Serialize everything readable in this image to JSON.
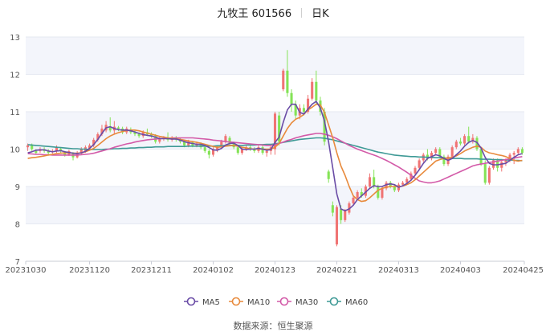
{
  "header": {
    "stock_name": "九牧王 601566",
    "period": "日K"
  },
  "footer": {
    "source": "数据来源：恒生聚源"
  },
  "colors": {
    "up": "#f07474",
    "down": "#84e356",
    "MA5": "#6a4ca6",
    "MA10": "#e88a3c",
    "MA30": "#d35aa8",
    "MA60": "#3f9a96",
    "grid": "#e6e9f2",
    "band": "#f3f5fb"
  },
  "chart_data": {
    "type": "candlestick",
    "title": "九牧王 601566",
    "ylim": [
      7,
      13
    ],
    "yticks": [
      7,
      8,
      9,
      10,
      11,
      12,
      13
    ],
    "xticks": [
      "20231030",
      "20231120",
      "20231211",
      "20240102",
      "20240123",
      "20240221",
      "20240313",
      "20240403",
      "20240425"
    ],
    "xtick_index": [
      0,
      15,
      30,
      45,
      60,
      75,
      90,
      105,
      120
    ],
    "n_bars": 121,
    "legend": [
      "MA5",
      "MA10",
      "MA30",
      "MA60"
    ],
    "legend_position": "bottom",
    "candles": [
      [
        10.05,
        10.1,
        9.95,
        10.15
      ],
      [
        10.1,
        10.0,
        9.95,
        10.15
      ],
      [
        9.95,
        9.9,
        9.85,
        10.0
      ],
      [
        9.95,
        10.0,
        9.9,
        10.05
      ],
      [
        10.0,
        9.95,
        9.9,
        10.05
      ],
      [
        9.95,
        9.9,
        9.85,
        10.0
      ],
      [
        9.92,
        9.95,
        9.88,
        10.0
      ],
      [
        9.95,
        10.05,
        9.9,
        10.1
      ],
      [
        10.0,
        9.95,
        9.9,
        10.05
      ],
      [
        9.9,
        9.85,
        9.8,
        9.95
      ],
      [
        9.85,
        9.95,
        9.82,
        9.98
      ],
      [
        9.88,
        9.78,
        9.7,
        9.92
      ],
      [
        9.78,
        9.9,
        9.75,
        9.95
      ],
      [
        9.88,
        10.0,
        9.85,
        10.05
      ],
      [
        9.95,
        10.05,
        9.9,
        10.1
      ],
      [
        10.02,
        10.1,
        10.0,
        10.15
      ],
      [
        10.1,
        10.25,
        10.05,
        10.3
      ],
      [
        10.25,
        10.4,
        10.2,
        10.45
      ],
      [
        10.4,
        10.55,
        10.35,
        10.65
      ],
      [
        10.5,
        10.65,
        10.45,
        10.75
      ],
      [
        10.6,
        10.5,
        10.45,
        10.85
      ],
      [
        10.5,
        10.6,
        10.4,
        10.75
      ],
      [
        10.58,
        10.55,
        10.48,
        10.62
      ],
      [
        10.55,
        10.45,
        10.4,
        10.6
      ],
      [
        10.45,
        10.55,
        10.4,
        10.6
      ],
      [
        10.52,
        10.45,
        10.4,
        10.58
      ],
      [
        10.45,
        10.4,
        10.35,
        10.5
      ],
      [
        10.4,
        10.35,
        10.3,
        10.45
      ],
      [
        10.35,
        10.45,
        10.3,
        10.5
      ],
      [
        10.45,
        10.4,
        10.35,
        10.55
      ],
      [
        10.4,
        10.35,
        10.3,
        10.45
      ],
      [
        10.35,
        10.2,
        10.15,
        10.4
      ],
      [
        10.2,
        10.3,
        10.15,
        10.35
      ],
      [
        10.28,
        10.3,
        10.22,
        10.35
      ],
      [
        10.3,
        10.25,
        10.2,
        10.45
      ],
      [
        10.25,
        10.3,
        10.2,
        10.35
      ],
      [
        10.3,
        10.25,
        10.2,
        10.35
      ],
      [
        10.25,
        10.2,
        10.15,
        10.3
      ],
      [
        10.2,
        10.1,
        10.05,
        10.25
      ],
      [
        10.1,
        10.2,
        10.05,
        10.25
      ],
      [
        10.18,
        10.1,
        10.05,
        10.22
      ],
      [
        10.1,
        10.15,
        10.05,
        10.2
      ],
      [
        10.12,
        10.05,
        10.0,
        10.18
      ],
      [
        10.05,
        9.95,
        9.9,
        10.1
      ],
      [
        9.95,
        9.85,
        9.75,
        10.0
      ],
      [
        9.85,
        10.0,
        9.8,
        10.05
      ],
      [
        9.98,
        10.05,
        9.92,
        10.1
      ],
      [
        10.05,
        10.2,
        10.0,
        10.25
      ],
      [
        10.2,
        10.35,
        10.15,
        10.4
      ],
      [
        10.3,
        10.15,
        10.1,
        10.35
      ],
      [
        10.15,
        10.05,
        10.0,
        10.2
      ],
      [
        10.05,
        9.9,
        9.85,
        10.1
      ],
      [
        9.9,
        10.0,
        9.85,
        10.05
      ],
      [
        10.0,
        10.05,
        9.95,
        10.1
      ],
      [
        10.05,
        10.0,
        9.95,
        10.1
      ],
      [
        10.0,
        9.95,
        9.9,
        10.05
      ],
      [
        9.95,
        10.05,
        9.9,
        10.1
      ],
      [
        10.05,
        9.9,
        9.85,
        10.1
      ],
      [
        9.9,
        9.95,
        9.8,
        10.0
      ],
      [
        9.95,
        10.05,
        9.85,
        10.1
      ],
      [
        10.0,
        10.95,
        9.85,
        11.0
      ],
      [
        10.9,
        10.2,
        10.1,
        11.0
      ],
      [
        11.6,
        12.1,
        11.55,
        12.15
      ],
      [
        12.1,
        11.5,
        11.4,
        12.65
      ],
      [
        11.5,
        11.2,
        11.0,
        11.6
      ],
      [
        11.2,
        10.9,
        10.8,
        11.3
      ],
      [
        10.9,
        11.1,
        10.8,
        11.2
      ],
      [
        11.1,
        11.0,
        10.9,
        11.2
      ],
      [
        11.0,
        11.35,
        10.95,
        11.45
      ],
      [
        11.35,
        11.8,
        11.3,
        11.9
      ],
      [
        11.8,
        11.3,
        11.2,
        12.1
      ],
      [
        11.3,
        11.0,
        10.9,
        11.4
      ],
      [
        11.0,
        10.2,
        10.1,
        11.1
      ],
      [
        9.4,
        9.2,
        9.1,
        9.45
      ],
      [
        8.5,
        8.3,
        8.2,
        8.6
      ],
      [
        7.45,
        8.45,
        7.4,
        8.5
      ],
      [
        8.4,
        8.1,
        8.0,
        8.5
      ],
      [
        8.1,
        8.35,
        8.05,
        8.4
      ],
      [
        8.3,
        8.55,
        8.25,
        8.6
      ],
      [
        8.55,
        8.7,
        8.5,
        8.75
      ],
      [
        8.7,
        8.85,
        8.65,
        8.9
      ],
      [
        8.85,
        8.75,
        8.7,
        8.95
      ],
      [
        8.75,
        9.0,
        8.7,
        9.05
      ],
      [
        9.0,
        9.25,
        8.95,
        9.35
      ],
      [
        9.25,
        9.0,
        8.95,
        9.45
      ],
      [
        9.0,
        8.7,
        8.65,
        9.05
      ],
      [
        8.7,
        8.95,
        8.65,
        9.0
      ],
      [
        8.95,
        9.1,
        8.9,
        9.15
      ],
      [
        9.1,
        9.0,
        8.95,
        9.15
      ],
      [
        9.0,
        8.9,
        8.85,
        9.05
      ],
      [
        8.9,
        9.05,
        8.85,
        9.1
      ],
      [
        9.05,
        9.1,
        9.0,
        9.15
      ],
      [
        9.1,
        9.2,
        9.05,
        9.25
      ],
      [
        9.2,
        9.35,
        9.15,
        9.4
      ],
      [
        9.35,
        9.5,
        9.3,
        9.55
      ],
      [
        9.5,
        9.7,
        9.45,
        9.75
      ],
      [
        9.7,
        9.85,
        9.65,
        9.9
      ],
      [
        9.85,
        9.75,
        9.7,
        10.0
      ],
      [
        9.75,
        9.9,
        9.7,
        9.95
      ],
      [
        9.9,
        10.0,
        9.85,
        10.05
      ],
      [
        10.0,
        9.8,
        9.75,
        10.05
      ],
      [
        9.8,
        9.6,
        9.55,
        9.85
      ],
      [
        9.6,
        9.8,
        9.55,
        9.85
      ],
      [
        9.8,
        10.05,
        9.75,
        10.1
      ],
      [
        10.05,
        10.2,
        10.0,
        10.25
      ],
      [
        10.2,
        10.15,
        10.1,
        10.3
      ],
      [
        10.15,
        10.35,
        10.1,
        10.4
      ],
      [
        10.35,
        10.2,
        10.15,
        10.6
      ],
      [
        10.2,
        10.3,
        10.15,
        10.4
      ],
      [
        10.3,
        10.0,
        9.95,
        10.35
      ],
      [
        10.0,
        9.6,
        9.55,
        10.05
      ],
      [
        9.6,
        9.1,
        9.05,
        9.7
      ],
      [
        9.1,
        9.5,
        9.05,
        9.55
      ],
      [
        9.5,
        9.7,
        9.45,
        9.75
      ],
      [
        9.7,
        9.5,
        9.4,
        9.75
      ],
      [
        9.5,
        9.65,
        9.4,
        9.7
      ],
      [
        9.65,
        9.7,
        9.55,
        9.75
      ],
      [
        9.7,
        9.85,
        9.65,
        9.9
      ],
      [
        9.85,
        9.9,
        9.6,
        9.95
      ],
      [
        9.9,
        10.0,
        9.85,
        10.05
      ],
      [
        10.0,
        9.9,
        9.85,
        10.05
      ]
    ],
    "series": [
      {
        "name": "MA5",
        "values": [
          9.9,
          9.93,
          9.97,
          9.98,
          9.98,
          9.95,
          9.93,
          9.95,
          9.96,
          9.93,
          9.91,
          9.89,
          9.88,
          9.9,
          9.94,
          10.02,
          10.12,
          10.26,
          10.42,
          10.57,
          10.6,
          10.55,
          10.52,
          10.51,
          10.51,
          10.49,
          10.46,
          10.42,
          10.39,
          10.37,
          10.35,
          10.32,
          10.28,
          10.28,
          10.28,
          10.27,
          10.27,
          10.24,
          10.2,
          10.17,
          10.15,
          10.13,
          10.13,
          10.1,
          10.04,
          9.98,
          9.97,
          10.02,
          10.11,
          10.15,
          10.16,
          10.1,
          10.0,
          9.99,
          10.0,
          10.0,
          10.02,
          10.0,
          9.97,
          9.99,
          10.18,
          10.32,
          10.72,
          11.05,
          11.2,
          11.2,
          10.98,
          10.94,
          11.07,
          11.2,
          11.28,
          11.1,
          10.75,
          10.2,
          9.5,
          8.8,
          8.4,
          8.35,
          8.4,
          8.5,
          8.65,
          8.75,
          8.85,
          8.95,
          9.02,
          9.0,
          9.0,
          9.05,
          9.07,
          9.05,
          8.98,
          9.02,
          9.08,
          9.17,
          9.3,
          9.45,
          9.62,
          9.75,
          9.8,
          9.85,
          9.82,
          9.75,
          9.7,
          9.75,
          9.85,
          9.95,
          10.08,
          10.18,
          10.23,
          10.18,
          10.03,
          9.78,
          9.62,
          9.58,
          9.58,
          9.6,
          9.62,
          9.7,
          9.78,
          9.85,
          9.88
        ]
      },
      {
        "name": "MA10",
        "values": [
          9.75,
          9.77,
          9.78,
          9.8,
          9.82,
          9.84,
          9.86,
          9.88,
          9.89,
          9.9,
          9.9,
          9.89,
          9.89,
          9.9,
          9.93,
          9.97,
          10.02,
          10.1,
          10.19,
          10.28,
          10.35,
          10.4,
          10.44,
          10.47,
          10.5,
          10.51,
          10.51,
          10.49,
          10.46,
          10.43,
          10.4,
          10.37,
          10.34,
          10.32,
          10.3,
          10.29,
          10.28,
          10.26,
          10.24,
          10.22,
          10.2,
          10.18,
          10.16,
          10.13,
          10.1,
          10.07,
          10.05,
          10.06,
          10.08,
          10.09,
          10.1,
          10.08,
          10.05,
          10.03,
          10.01,
          10.0,
          10.0,
          10.0,
          10.0,
          10.0,
          10.05,
          10.15,
          10.35,
          10.55,
          10.7,
          10.8,
          10.85,
          10.93,
          11.05,
          11.12,
          11.2,
          11.18,
          10.98,
          10.65,
          10.3,
          9.9,
          9.55,
          9.3,
          9.0,
          8.75,
          8.65,
          8.6,
          8.62,
          8.7,
          8.8,
          8.9,
          8.95,
          8.98,
          9.0,
          9.0,
          9.0,
          9.01,
          9.05,
          9.1,
          9.18,
          9.28,
          9.38,
          9.48,
          9.58,
          9.68,
          9.72,
          9.75,
          9.76,
          9.78,
          9.82,
          9.88,
          9.95,
          10.0,
          10.05,
          10.08,
          10.05,
          9.95,
          9.9,
          9.88,
          9.85,
          9.83,
          9.8,
          9.75,
          9.7,
          9.68,
          9.7
        ]
      },
      {
        "name": "MA30",
        "values": [
          9.88,
          9.87,
          9.86,
          9.86,
          9.85,
          9.85,
          9.84,
          9.84,
          9.84,
          9.84,
          9.84,
          9.84,
          9.84,
          9.85,
          9.86,
          9.87,
          9.89,
          9.92,
          9.95,
          9.98,
          10.01,
          10.05,
          10.08,
          10.11,
          10.14,
          10.16,
          10.19,
          10.21,
          10.23,
          10.25,
          10.26,
          10.27,
          10.28,
          10.29,
          10.29,
          10.3,
          10.3,
          10.3,
          10.3,
          10.3,
          10.3,
          10.29,
          10.28,
          10.27,
          10.26,
          10.24,
          10.23,
          10.22,
          10.2,
          10.19,
          10.18,
          10.17,
          10.16,
          10.15,
          10.14,
          10.13,
          10.12,
          10.11,
          10.1,
          10.1,
          10.12,
          10.15,
          10.19,
          10.23,
          10.26,
          10.3,
          10.33,
          10.36,
          10.38,
          10.4,
          10.42,
          10.42,
          10.4,
          10.37,
          10.33,
          10.28,
          10.22,
          10.16,
          10.1,
          10.05,
          10.0,
          9.96,
          9.92,
          9.88,
          9.84,
          9.8,
          9.75,
          9.7,
          9.64,
          9.58,
          9.52,
          9.45,
          9.38,
          9.3,
          9.22,
          9.15,
          9.12,
          9.1,
          9.1,
          9.12,
          9.15,
          9.2,
          9.25,
          9.3,
          9.35,
          9.4,
          9.45,
          9.5,
          9.55,
          9.58,
          9.6,
          9.62,
          9.64,
          9.66,
          9.68,
          9.7,
          9.72,
          9.74,
          9.76,
          9.78,
          9.8
        ]
      },
      {
        "name": "MA60",
        "values": [
          10.12,
          10.11,
          10.1,
          10.09,
          10.08,
          10.07,
          10.06,
          10.05,
          10.04,
          10.03,
          10.02,
          10.01,
          10.01,
          10.0,
          10.0,
          9.99,
          9.99,
          9.99,
          9.99,
          10.0,
          10.0,
          10.01,
          10.01,
          10.02,
          10.02,
          10.03,
          10.03,
          10.04,
          10.04,
          10.05,
          10.05,
          10.06,
          10.06,
          10.06,
          10.07,
          10.07,
          10.07,
          10.07,
          10.07,
          10.08,
          10.08,
          10.08,
          10.08,
          10.08,
          10.08,
          10.08,
          10.09,
          10.09,
          10.1,
          10.1,
          10.1,
          10.1,
          10.1,
          10.11,
          10.11,
          10.11,
          10.12,
          10.12,
          10.13,
          10.13,
          10.14,
          10.16,
          10.18,
          10.2,
          10.22,
          10.24,
          10.26,
          10.27,
          10.28,
          10.29,
          10.3,
          10.3,
          10.29,
          10.27,
          10.25,
          10.22,
          10.19,
          10.16,
          10.13,
          10.1,
          10.07,
          10.04,
          10.01,
          9.98,
          9.95,
          9.92,
          9.9,
          9.88,
          9.86,
          9.84,
          9.83,
          9.82,
          9.81,
          9.8,
          9.8,
          9.79,
          9.79,
          9.78,
          9.78,
          9.77,
          9.77,
          9.76,
          9.76,
          9.75,
          9.75,
          9.75,
          9.74,
          9.74,
          9.74,
          9.74,
          9.73,
          9.73,
          9.73,
          9.72,
          9.72,
          9.72,
          9.71,
          9.71,
          9.7,
          9.7,
          9.69
        ]
      }
    ]
  }
}
